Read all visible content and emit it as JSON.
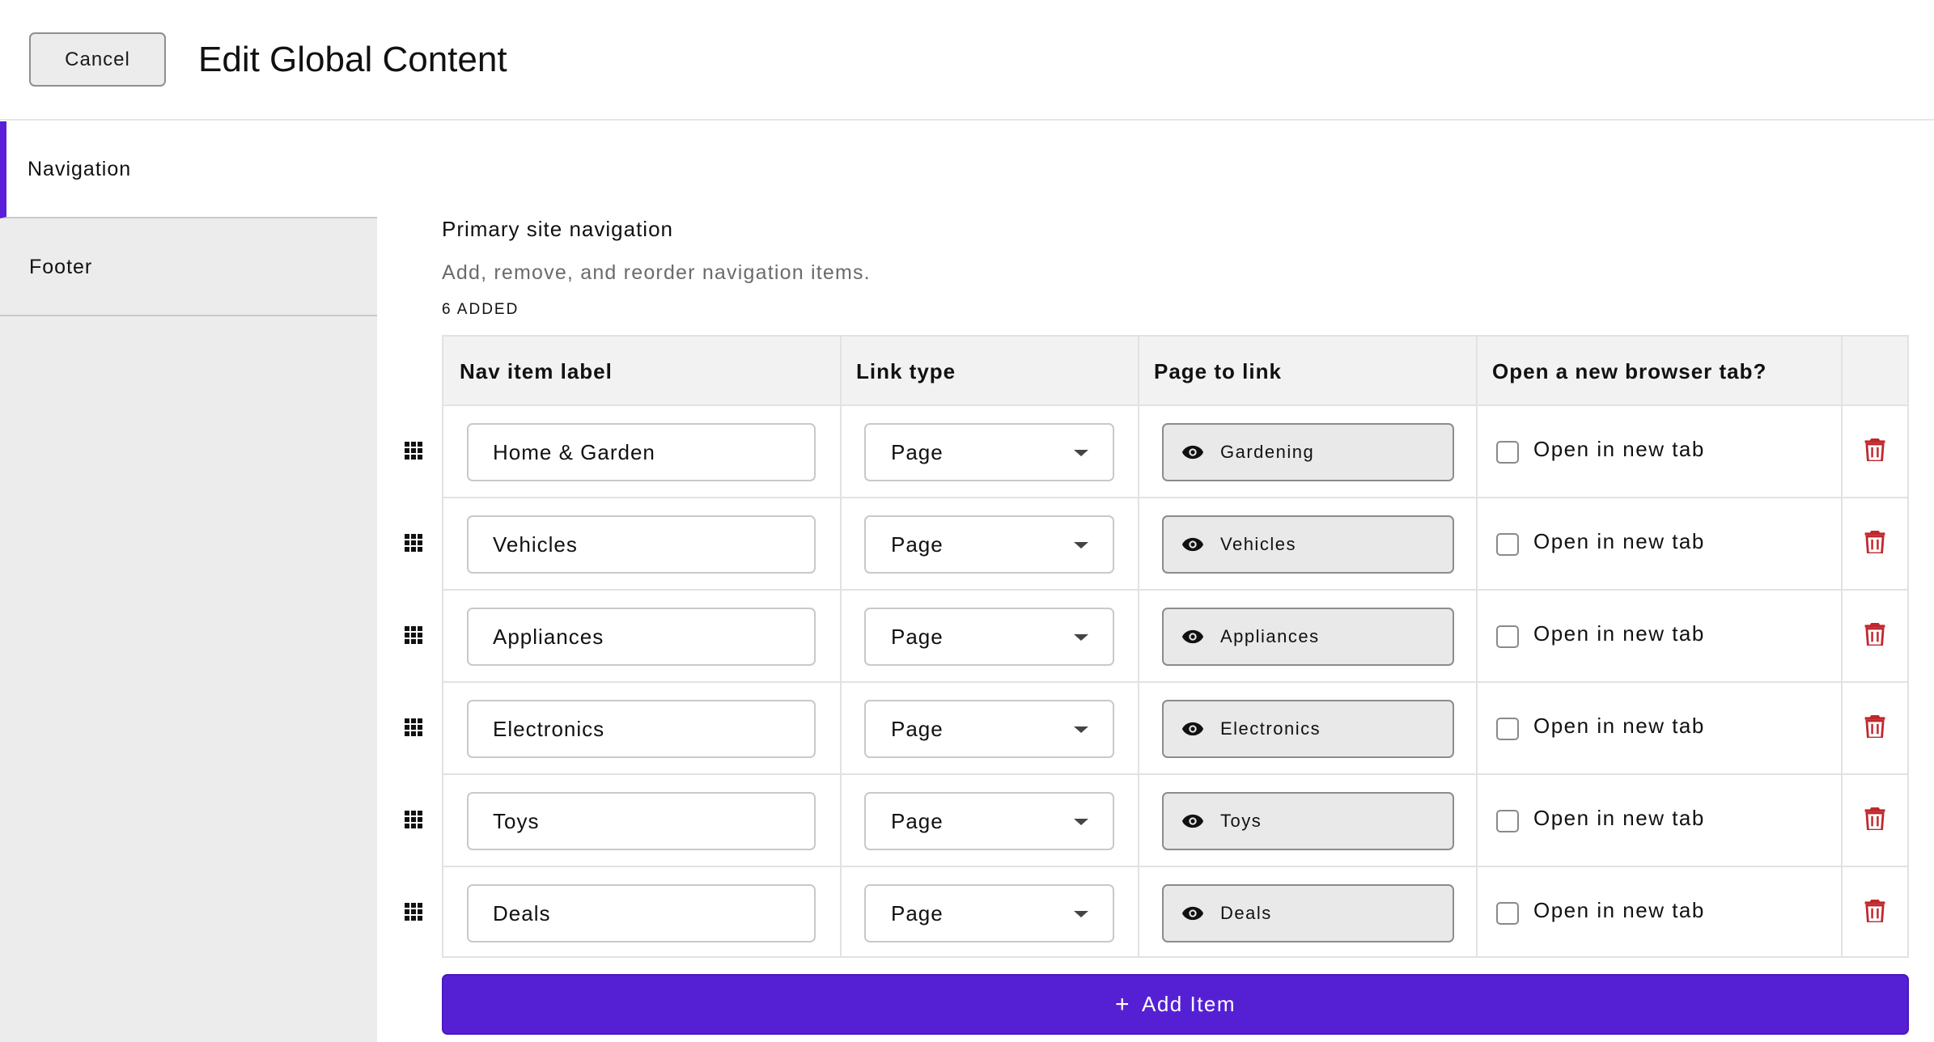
{
  "header": {
    "cancel_label": "Cancel",
    "title": "Edit Global Content"
  },
  "sidebar": {
    "items": [
      {
        "label": "Navigation",
        "active": true
      },
      {
        "label": "Footer",
        "active": false
      }
    ],
    "accent_color": "#5a1fd6"
  },
  "section": {
    "title": "Primary site navigation",
    "description": "Add, remove, and reorder navigation items.",
    "count_label": "6 ADDED"
  },
  "table": {
    "headers": [
      "Nav item label",
      "Link type",
      "Page to link",
      "Open a new browser tab?"
    ],
    "rows": [
      {
        "label": "Home & Garden",
        "link_type": "Page",
        "page": "Gardening",
        "new_tab_label": "Open in new tab",
        "new_tab": false
      },
      {
        "label": "Vehicles",
        "link_type": "Page",
        "page": "Vehicles",
        "new_tab_label": "Open in new tab",
        "new_tab": false
      },
      {
        "label": "Appliances",
        "link_type": "Page",
        "page": "Appliances",
        "new_tab_label": "Open in new tab",
        "new_tab": false
      },
      {
        "label": "Electronics",
        "link_type": "Page",
        "page": "Electronics",
        "new_tab_label": "Open in new tab",
        "new_tab": false
      },
      {
        "label": "Toys",
        "link_type": "Page",
        "page": "Toys",
        "new_tab_label": "Open in new tab",
        "new_tab": false
      },
      {
        "label": "Deals",
        "link_type": "Page",
        "page": "Deals",
        "new_tab_label": "Open in new tab",
        "new_tab": false
      }
    ],
    "icons": {
      "drag": "drag-handle-icon",
      "page": "eye-icon",
      "delete": "trash-icon",
      "select": "chevron-down-icon"
    },
    "delete_color": "#c0282d"
  },
  "add_button": {
    "label": "Add Item",
    "color": "#5520d4"
  }
}
